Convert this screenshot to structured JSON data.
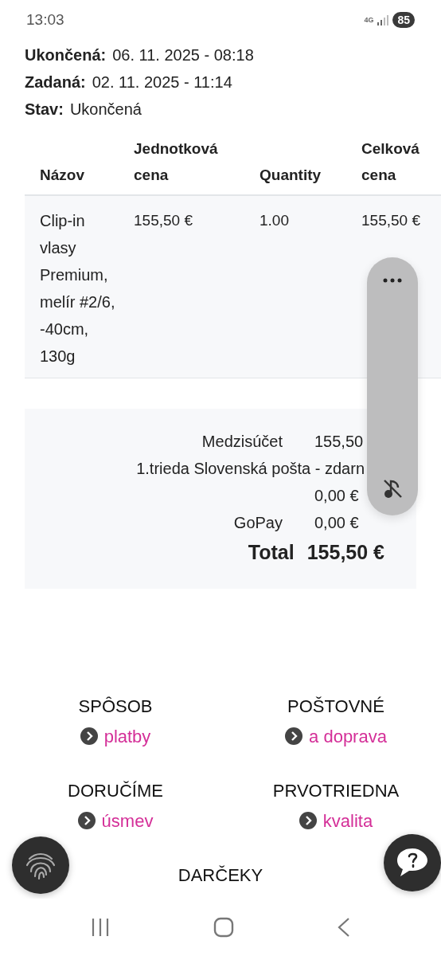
{
  "status_bar": {
    "time": "13:03",
    "network": "4G",
    "battery": "85"
  },
  "order_info": [
    {
      "label": "Ukončená:",
      "value": "06. 11. 2025 - 08:18"
    },
    {
      "label": "Zadaná:",
      "value": "02. 11. 2025 - 11:14"
    },
    {
      "label": "Stav:",
      "value": "Ukončená"
    }
  ],
  "table": {
    "columns": [
      "Názov",
      "Jednotková cena",
      "Quantity",
      "Celková cena"
    ],
    "rows": [
      {
        "cells": [
          "Clip-in vlasy Premium, melír #2/6, -40cm, 130g",
          "155,50 €",
          "1.00",
          "155,50 €"
        ]
      }
    ]
  },
  "summary": {
    "rows": [
      {
        "label": "Medzisúčet",
        "value": "155,50"
      },
      {
        "kind": "wide",
        "label": "1.trieda Slovenská pošta - zdarn",
        "value": "0,00 €"
      },
      {
        "label": "GoPay",
        "value": "0,00 €"
      }
    ],
    "total": {
      "label": "Total",
      "value": "155,50 €"
    }
  },
  "footer_links": [
    {
      "heading": "SPÔSOB",
      "link": "platby"
    },
    {
      "heading": "POŠTOVNÉ",
      "link": "a doprava"
    },
    {
      "heading": "DORUČÍME",
      "link": "úsmev"
    },
    {
      "heading": "PRVOTRIEDNA",
      "link": "kvalita"
    },
    {
      "heading": "DARČEKY"
    }
  ]
}
